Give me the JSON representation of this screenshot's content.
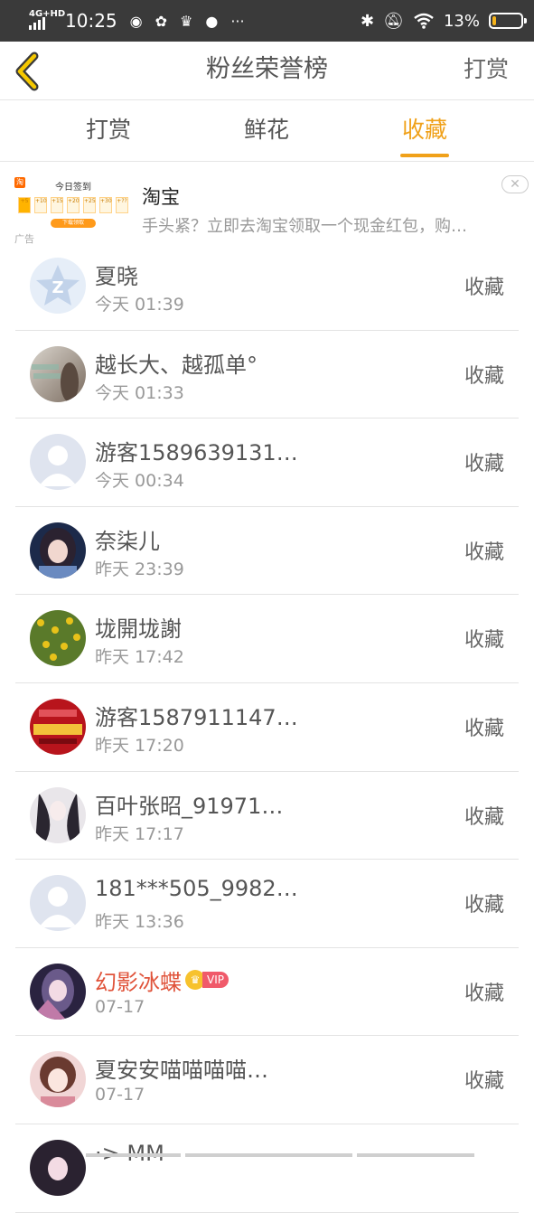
{
  "status_bar": {
    "network": "4G+HD",
    "time": "10:25",
    "app_icons": [
      "vivo",
      "wechat",
      "crown",
      "message",
      "more"
    ],
    "battery_percent": "13%",
    "battery_level": 0.13,
    "battery_color": "#f5b31a"
  },
  "header": {
    "title": "粉丝荣誉榜",
    "right_action": "打赏"
  },
  "tabs": [
    {
      "label": "打赏",
      "active": false
    },
    {
      "label": "鲜花",
      "active": false
    },
    {
      "label": "收藏",
      "active": true
    }
  ],
  "accent_color": "#f0a11a",
  "ad": {
    "thumb_title": "今日签到",
    "thumb_steps": [
      "+5",
      "+10",
      "+15",
      "+20",
      "+25",
      "+30",
      "+??"
    ],
    "thumb_button": "下载领取",
    "label": "广告",
    "name": "淘宝",
    "description": "手头紧？立即去淘宝领取一个现金红包，购…",
    "close_icon": "close-icon"
  },
  "fans": [
    {
      "name": "夏晓",
      "time": "今天 01:39",
      "action": "收藏",
      "vip": false,
      "avatar": "default-z"
    },
    {
      "name": "越长大、越孤单°",
      "time": "今天 01:33",
      "action": "收藏",
      "vip": false,
      "avatar": "photo-grey"
    },
    {
      "name": "游客1589639131…",
      "time": "今天 00:34",
      "action": "收藏",
      "vip": false,
      "avatar": "default-person"
    },
    {
      "name": "奈柒儿",
      "time": "昨天 23:39",
      "action": "收藏",
      "vip": false,
      "avatar": "anime-dark"
    },
    {
      "name": "垅開垅謝",
      "time": "昨天 17:42",
      "action": "收藏",
      "vip": false,
      "avatar": "flowers"
    },
    {
      "name": "游客1587911147…",
      "time": "昨天 17:20",
      "action": "收藏",
      "vip": false,
      "avatar": "festival-red"
    },
    {
      "name": "百叶张昭_91971…",
      "time": "昨天 17:17",
      "action": "收藏",
      "vip": false,
      "avatar": "anime-bw"
    },
    {
      "name": "181***505_9982…",
      "time": "昨天 13:36",
      "action": "收藏",
      "vip": false,
      "avatar": "default-person"
    },
    {
      "name": "幻影冰蝶",
      "time": "07-17",
      "action": "收藏",
      "vip": true,
      "vip_label": "VIP",
      "avatar": "anime-pink"
    },
    {
      "name": "夏安安喵喵喵喵…",
      "time": "07-17",
      "action": "收藏",
      "vip": false,
      "avatar": "anime-girl"
    },
    {
      "name": "·> MM",
      "time": "",
      "action": "",
      "vip": false,
      "avatar": "anime-dark"
    }
  ]
}
